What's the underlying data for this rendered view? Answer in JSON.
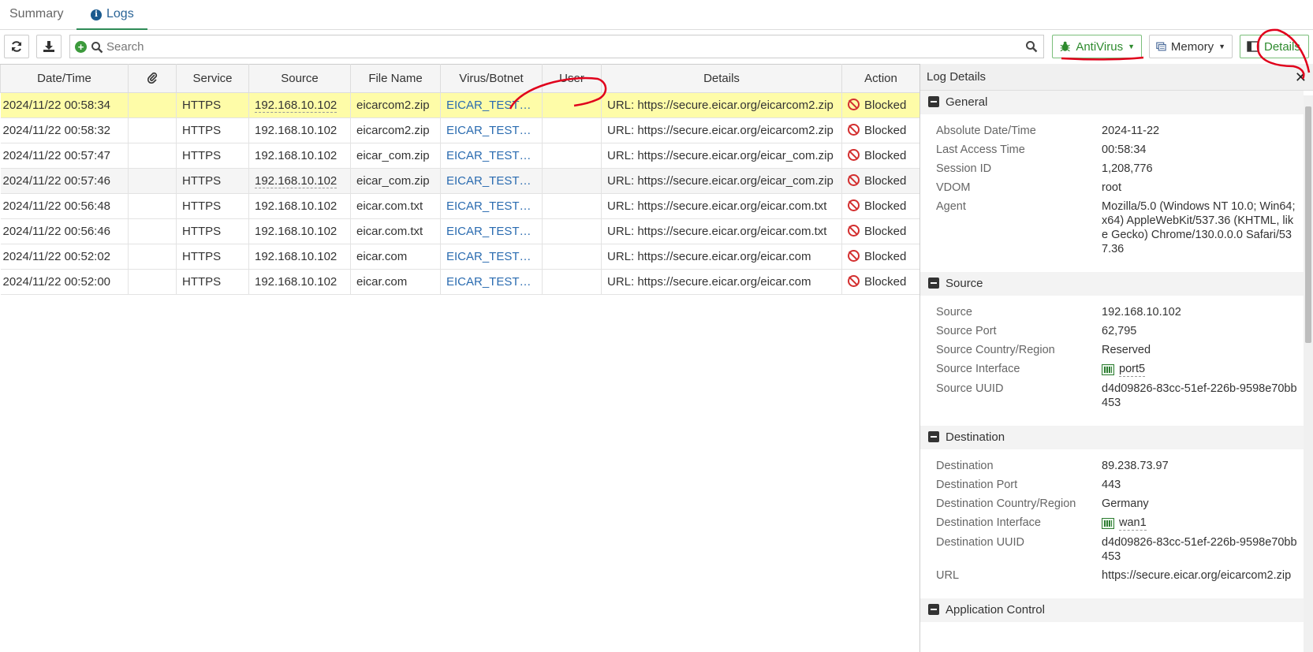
{
  "tabs": [
    {
      "label": "Summary"
    },
    {
      "label": "Logs"
    }
  ],
  "toolbar": {
    "search_placeholder": "Search",
    "antivirus_label": "AntiVirus",
    "memory_label": "Memory",
    "details_label": "Details"
  },
  "table": {
    "columns": [
      "Date/Time",
      "",
      "Service",
      "Source",
      "File Name",
      "Virus/Botnet",
      "User",
      "Details",
      "Action"
    ],
    "rows": [
      {
        "datetime": "2024/11/22 00:58:34",
        "service": "HTTPS",
        "source": "192.168.10.102",
        "file": "eicarcom2.zip",
        "virus": "EICAR_TEST_FI...",
        "user": "",
        "details": "URL: https://secure.eicar.org/eicarcom2.zip",
        "action": "Blocked"
      },
      {
        "datetime": "2024/11/22 00:58:32",
        "service": "HTTPS",
        "source": "192.168.10.102",
        "file": "eicarcom2.zip",
        "virus": "EICAR_TEST_FI...",
        "user": "",
        "details": "URL: https://secure.eicar.org/eicarcom2.zip",
        "action": "Blocked"
      },
      {
        "datetime": "2024/11/22 00:57:47",
        "service": "HTTPS",
        "source": "192.168.10.102",
        "file": "eicar_com.zip",
        "virus": "EICAR_TEST_FI...",
        "user": "",
        "details": "URL: https://secure.eicar.org/eicar_com.zip",
        "action": "Blocked"
      },
      {
        "datetime": "2024/11/22 00:57:46",
        "service": "HTTPS",
        "source": "192.168.10.102",
        "file": "eicar_com.zip",
        "virus": "EICAR_TEST_FI...",
        "user": "",
        "details": "URL: https://secure.eicar.org/eicar_com.zip",
        "action": "Blocked"
      },
      {
        "datetime": "2024/11/22 00:56:48",
        "service": "HTTPS",
        "source": "192.168.10.102",
        "file": "eicar.com.txt",
        "virus": "EICAR_TEST_FI...",
        "user": "",
        "details": "URL: https://secure.eicar.org/eicar.com.txt",
        "action": "Blocked"
      },
      {
        "datetime": "2024/11/22 00:56:46",
        "service": "HTTPS",
        "source": "192.168.10.102",
        "file": "eicar.com.txt",
        "virus": "EICAR_TEST_FI...",
        "user": "",
        "details": "URL: https://secure.eicar.org/eicar.com.txt",
        "action": "Blocked"
      },
      {
        "datetime": "2024/11/22 00:52:02",
        "service": "HTTPS",
        "source": "192.168.10.102",
        "file": "eicar.com",
        "virus": "EICAR_TEST_FI...",
        "user": "",
        "details": "URL: https://secure.eicar.org/eicar.com",
        "action": "Blocked"
      },
      {
        "datetime": "2024/11/22 00:52:00",
        "service": "HTTPS",
        "source": "192.168.10.102",
        "file": "eicar.com",
        "virus": "EICAR_TEST_FI...",
        "user": "",
        "details": "URL: https://secure.eicar.org/eicar.com",
        "action": "Blocked"
      }
    ]
  },
  "panel": {
    "title": "Log Details",
    "general": {
      "title": "General",
      "fields": [
        {
          "k": "Absolute Date/Time",
          "v": "2024-11-22"
        },
        {
          "k": "Last Access Time",
          "v": "00:58:34"
        },
        {
          "k": "Session ID",
          "v": "1,208,776"
        },
        {
          "k": "VDOM",
          "v": "root"
        },
        {
          "k": "Agent",
          "v": "Mozilla/5.0 (Windows NT 10.0; Win64; x64) AppleWebKit/537.36 (KHTML, like Gecko) Chrome/130.0.0.0 Safari/537.36"
        }
      ]
    },
    "source": {
      "title": "Source",
      "source": {
        "k": "Source",
        "v": "192.168.10.102"
      },
      "port": {
        "k": "Source Port",
        "v": "62,795"
      },
      "country": {
        "k": "Source Country/Region",
        "v": "Reserved"
      },
      "iface": {
        "k": "Source Interface",
        "v": "port5"
      },
      "uuid": {
        "k": "Source UUID",
        "v": "d4d09826-83cc-51ef-226b-9598e70bb453"
      }
    },
    "destination": {
      "title": "Destination",
      "dest": {
        "k": "Destination",
        "v": "89.238.73.97"
      },
      "port": {
        "k": "Destination Port",
        "v": "443"
      },
      "country": {
        "k": "Destination Country/Region",
        "v": "Germany"
      },
      "iface": {
        "k": "Destination Interface",
        "v": "wan1"
      },
      "uuid": {
        "k": "Destination UUID",
        "v": "d4d09826-83cc-51ef-226b-9598e70bb453"
      },
      "url": {
        "k": "URL",
        "v": "https://secure.eicar.org/eicarcom2.zip"
      }
    },
    "appcontrol": {
      "title": "Application Control"
    }
  },
  "colors": {
    "accent_green": "#2e8b2e",
    "selected_row": "#fefca8",
    "blocked_red": "#d32f2f",
    "link_blue": "#2a6bb0",
    "annotation_red": "#e0001b"
  }
}
